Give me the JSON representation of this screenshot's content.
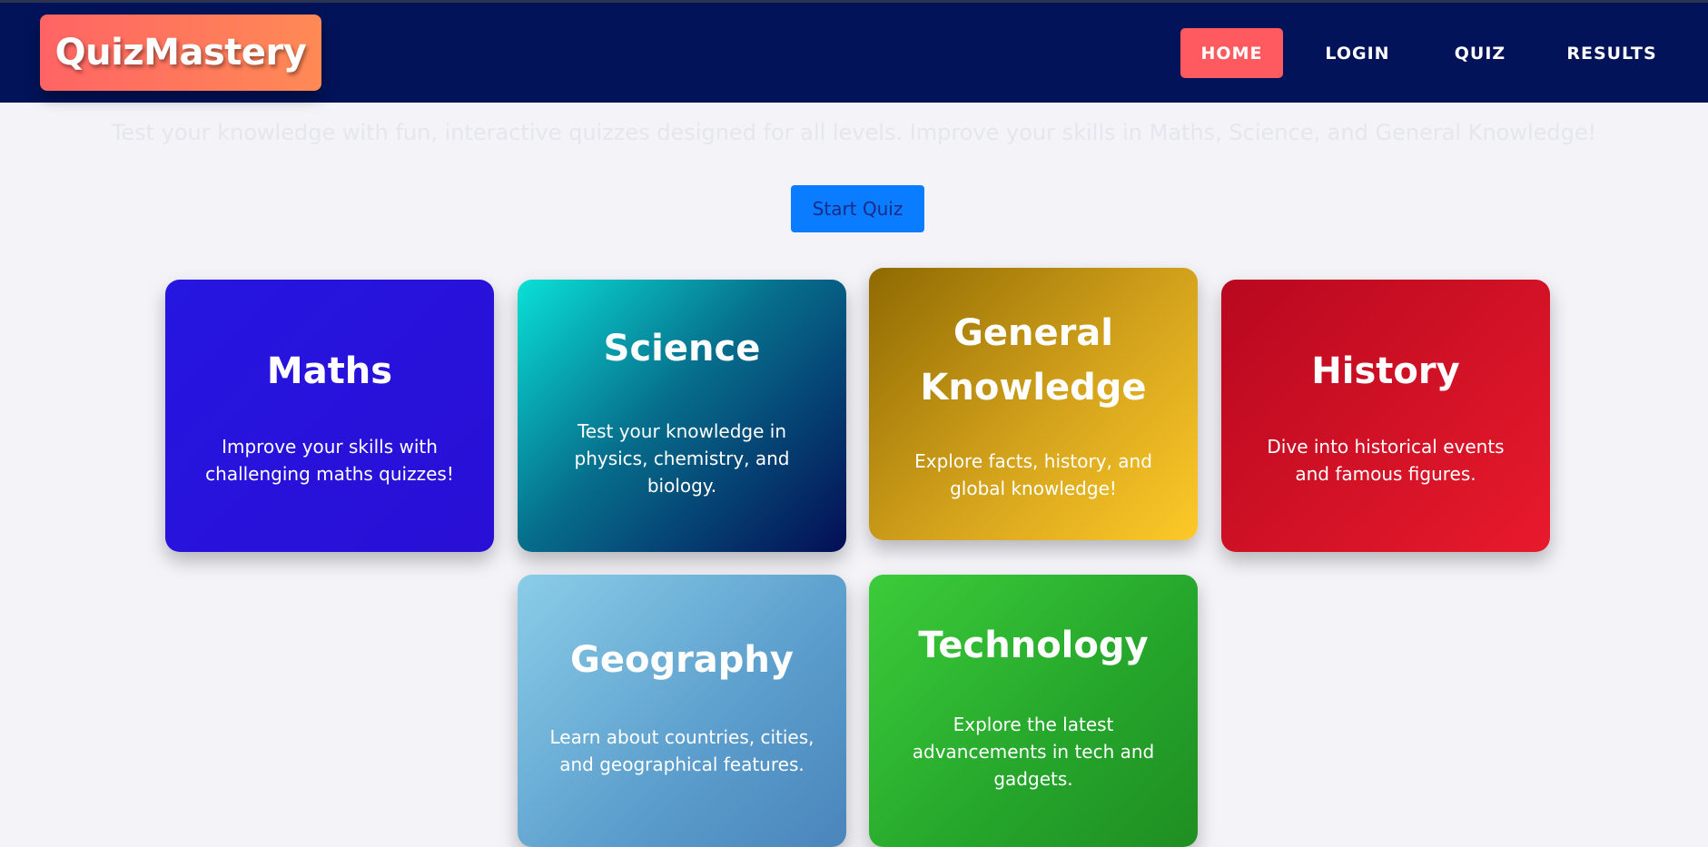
{
  "header": {
    "logo": "QuizMastery",
    "nav": {
      "home": "HOME",
      "login": "LOGIN",
      "quiz": "QUIZ",
      "results": "RESULTS"
    }
  },
  "hero": {
    "subtitle": "Test your knowledge with fun, interactive quizzes designed for all levels. Improve your skills in Maths, Science, and General Knowledge!",
    "start_button": "Start Quiz"
  },
  "cards": [
    {
      "title": "Maths",
      "description": "Improve your skills with challenging maths quizzes!"
    },
    {
      "title": "Science",
      "description": "Test your knowledge in physics, chemistry, and biology."
    },
    {
      "title": "General Knowledge",
      "description": "Explore facts, history, and global knowledge!"
    },
    {
      "title": "History",
      "description": "Dive into historical events and famous figures."
    },
    {
      "title": "Geography",
      "description": "Learn about countries, cities, and geographical features."
    },
    {
      "title": "Technology",
      "description": "Explore the latest advancements in tech and gadgets."
    }
  ],
  "colors": {
    "navbar": "#02135a",
    "active_nav": "#ff5a5f",
    "start_button": "#0a7cff"
  }
}
